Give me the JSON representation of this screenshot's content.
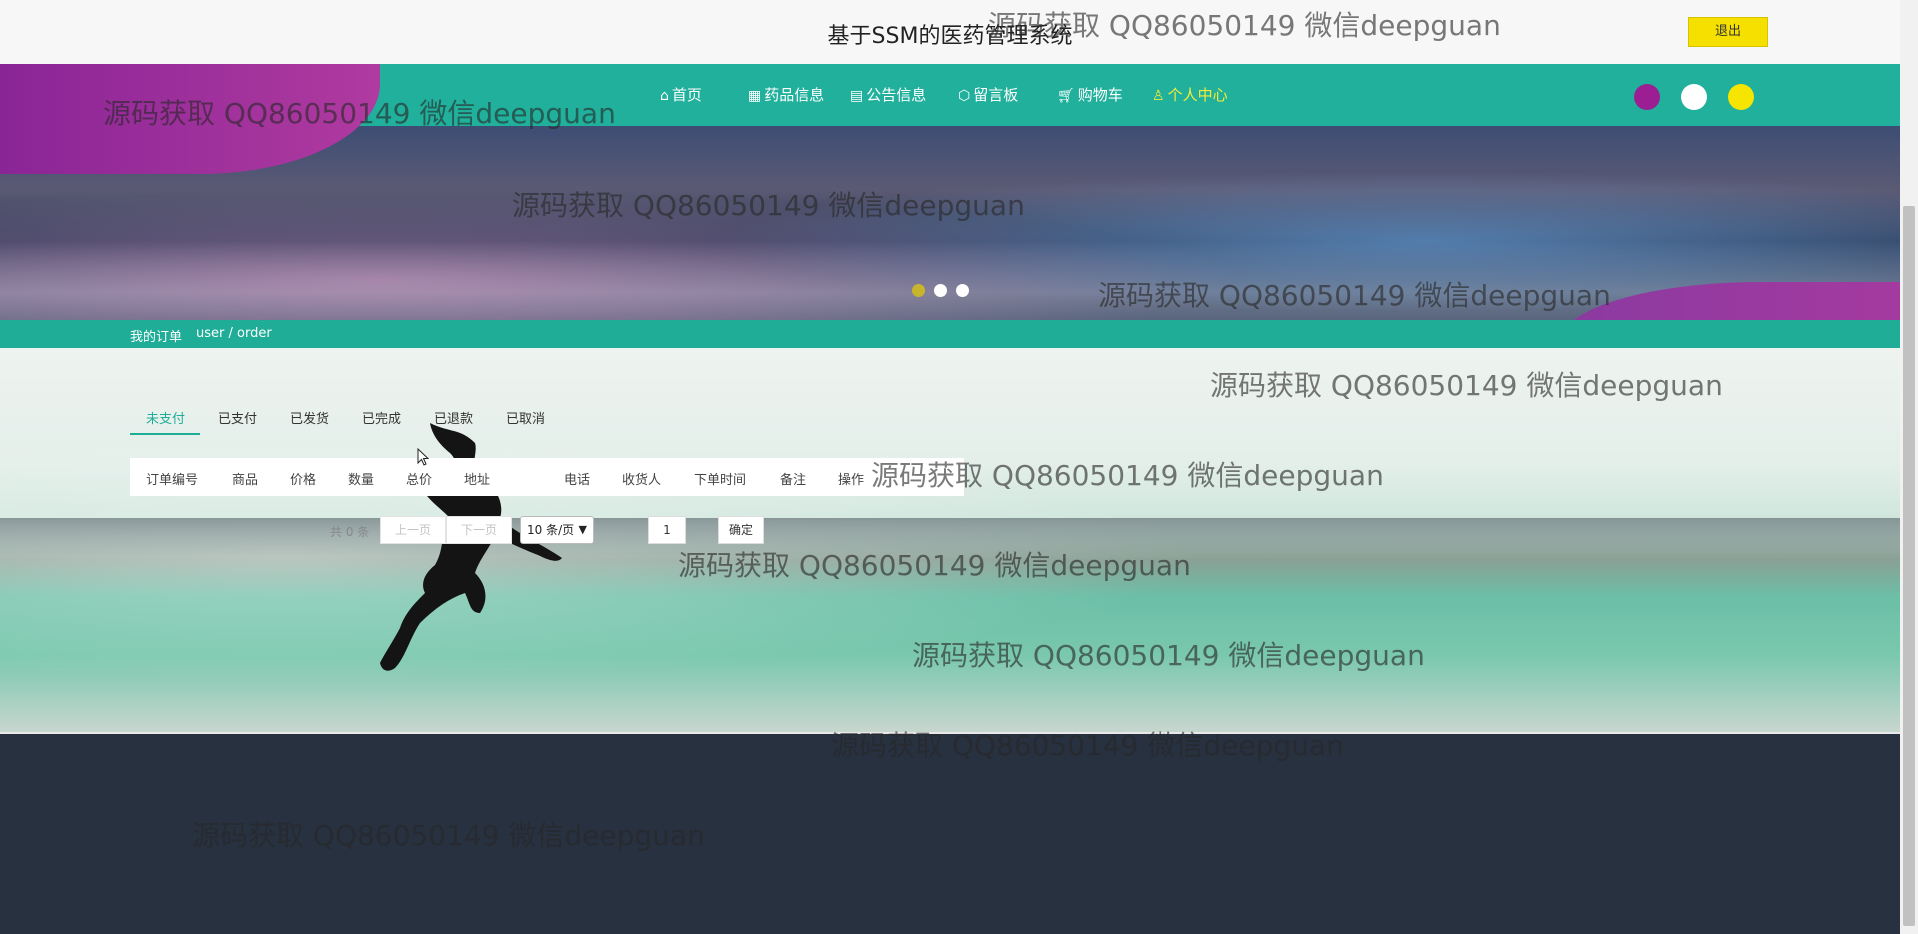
{
  "header": {
    "site_title": "基于SSM的医药管理系统",
    "logout_label": "退出"
  },
  "nav": {
    "items": [
      {
        "icon": "home-icon",
        "label": "首页"
      },
      {
        "icon": "grid-icon",
        "label": "药品信息"
      },
      {
        "icon": "notice-icon",
        "label": "公告信息"
      },
      {
        "icon": "box-icon",
        "label": "留言板"
      },
      {
        "icon": "cart-icon",
        "label": "购物车"
      },
      {
        "icon": "user-icon",
        "label": "个人中心"
      }
    ],
    "active": "个人中心",
    "theme_colors": [
      "#9b1f92",
      "#ffffff",
      "#f5e500"
    ]
  },
  "carousel": {
    "slides": 3,
    "active_index": 0,
    "active_color": "#c9b52c"
  },
  "breadcrumb": {
    "title": "我的订单",
    "path": "user / order"
  },
  "orders": {
    "tabs": [
      "未支付",
      "已支付",
      "已发货",
      "已完成",
      "已退款",
      "已取消"
    ],
    "active_tab": "未支付",
    "columns": [
      "订单编号",
      "商品",
      "价格",
      "数量",
      "总价",
      "地址",
      "电话",
      "收货人",
      "下单时间",
      "备注",
      "操作"
    ],
    "rows": []
  },
  "pagination": {
    "total_text": "共 0 条",
    "prev_label": "上一页",
    "next_label": "下一页",
    "page_size_label": "10 条/页",
    "page_input": "1",
    "confirm_label": "确定"
  },
  "watermarks": [
    "源码获取 QQ86050149 微信deepguan",
    "源码获取 QQ86050149 微信deepguan",
    "源码获取 QQ86050149 微信deepguan",
    "源码获取 QQ86050149 微信deepguan",
    "源码获取 QQ86050149 微信deepguan",
    "源码获取 QQ86050149 微信deepguan",
    "源码获取 QQ86050149 微信deepguan",
    "源码获取 QQ86050149 微信deepguan",
    "源码获取 QQ86050149 微信deepguan",
    "源码获取 QQ86050149 微信deepguan"
  ],
  "colors": {
    "accent": "#1fad98",
    "logout_bg": "#f5e000",
    "footer_bg": "#27313f",
    "nav_active": "#f3ec3a"
  }
}
